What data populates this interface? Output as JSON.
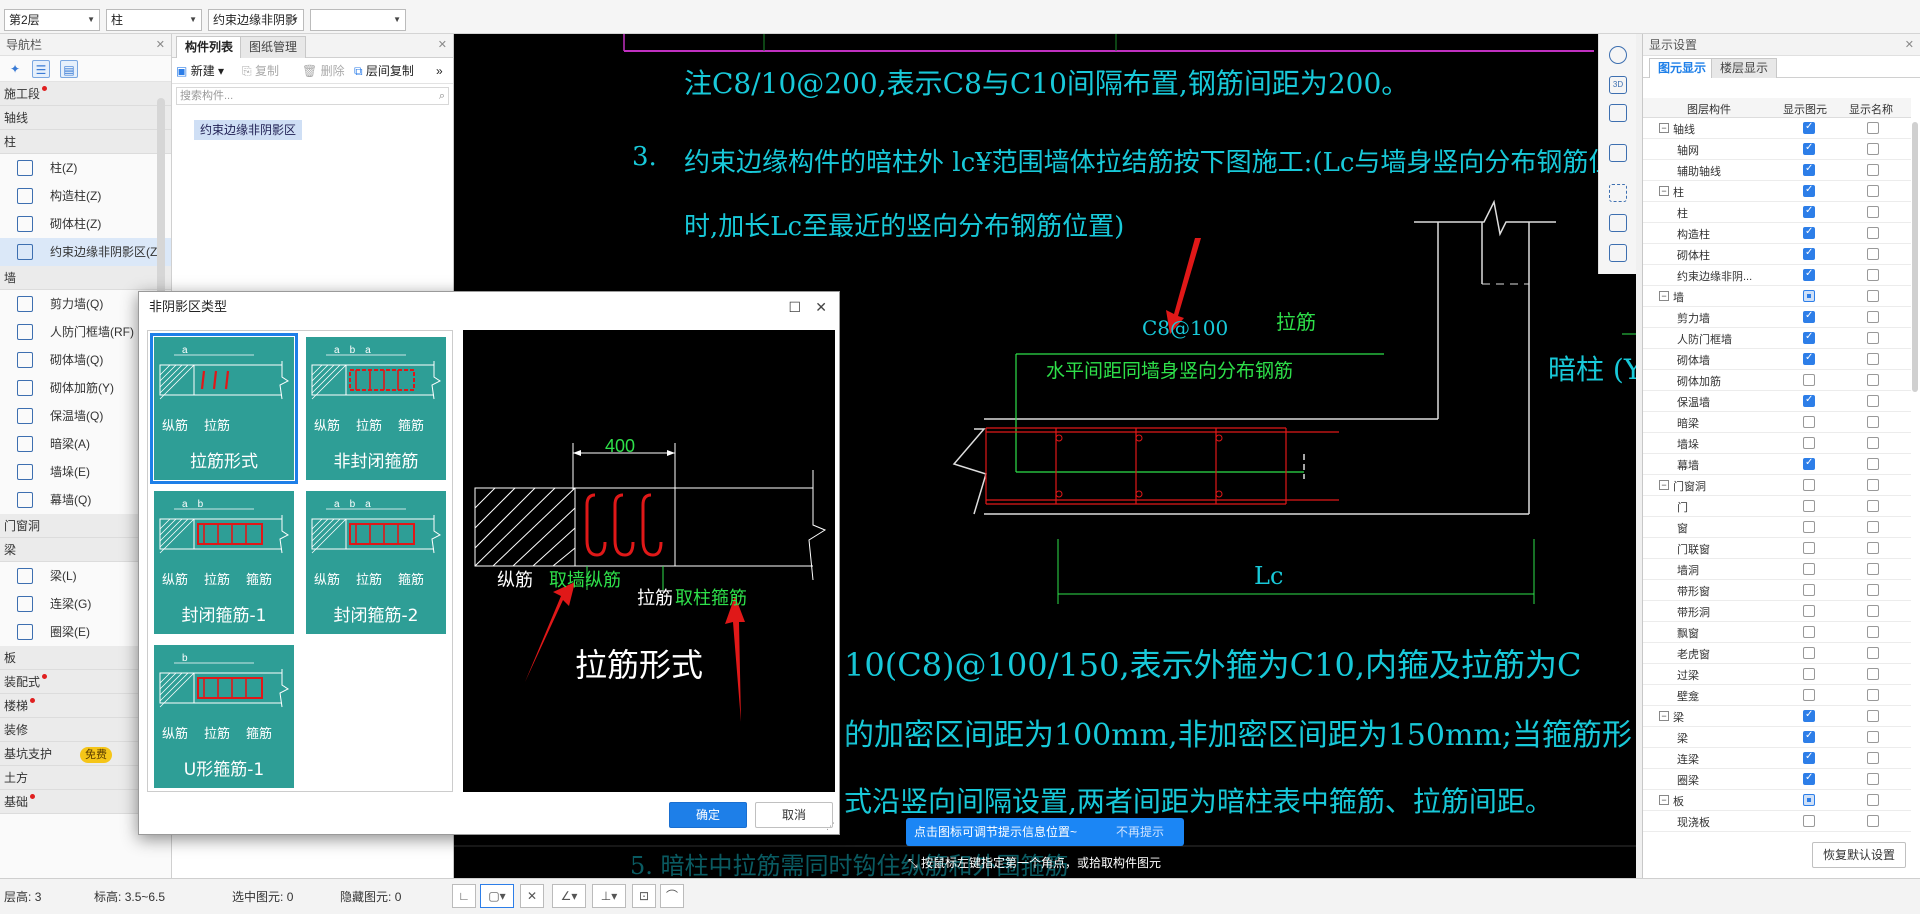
{
  "topbar": {
    "floor": "第2层",
    "type": "柱",
    "component": "约束边缘非阴影",
    "extra": ""
  },
  "nav": {
    "title": "导航栏",
    "categories_top": [
      {
        "label": "施工段",
        "dot": true
      },
      {
        "label": "轴线",
        "dot": false
      },
      {
        "label": "柱",
        "dot": false
      }
    ],
    "column_items": [
      {
        "label": "柱(Z)"
      },
      {
        "label": "构造柱(Z)"
      },
      {
        "label": "砌体柱(Z)"
      },
      {
        "label": "约束边缘非阴影区(Z"
      }
    ],
    "wall_cat": "墙",
    "wall_items": [
      {
        "label": "剪力墙(Q)"
      },
      {
        "label": "人防门框墙(RF)"
      },
      {
        "label": "砌体墙(Q)"
      },
      {
        "label": "砌体加筋(Y)"
      },
      {
        "label": "保温墙(Q)"
      },
      {
        "label": "暗梁(A)"
      },
      {
        "label": "墙垛(E)"
      },
      {
        "label": "幕墙(Q)"
      }
    ],
    "door_cat": "门窗洞",
    "beam_cat": "梁",
    "beam_items": [
      {
        "label": "梁(L)"
      },
      {
        "label": "连梁(G)"
      },
      {
        "label": "圈梁(E)"
      }
    ],
    "categories_bottom": [
      {
        "label": "板",
        "dot": false
      },
      {
        "label": "装配式",
        "dot": true
      },
      {
        "label": "楼梯",
        "dot": true
      },
      {
        "label": "装修",
        "dot": false
      },
      {
        "label": "基坑支护",
        "dot": false,
        "badge": "免费"
      },
      {
        "label": "土方",
        "dot": false
      },
      {
        "label": "基础",
        "dot": true
      }
    ]
  },
  "comp": {
    "tab1": "构件列表",
    "tab2": "图纸管理",
    "new": "新建",
    "copy": "复制",
    "delete": "删除",
    "floor_copy": "层间复制",
    "search_placeholder": "搜索构件...",
    "item": "约束边缘非阴影区"
  },
  "cad": {
    "line1": "注C8/10@200,表示C8与C10间隔布置,钢筋间距为200。",
    "num3": "3.",
    "line2": "约束边缘构件的暗柱外 lc¥范围墙体拉结筋按下图施工:(Lc与墙身竖向分布钢筋位置不同",
    "line3": "时,加长Lc至最近的竖向分布钢筋位置)",
    "label_c8": "C8@100",
    "label_lajin": "拉筋",
    "label_horizontal": "水平间距同墙身竖向分布钢筋",
    "label_anzhu": "暗柱 (Y",
    "label_lc": "Lc",
    "line4": "10(C8)@100/150,表示外箍为C10,内箍及拉筋为C",
    "line5": "的加密区间距为100mm,非加密区间距为150mm;当箍筋形",
    "line6": "式沿竖向间隔设置,两者间距为暗柱表中箍筋、拉筋间距。",
    "line7": "5.  暗柱中拉筋需同时钩住纵筋和外围箍筋"
  },
  "dialog": {
    "title": "非阴影区类型",
    "tiles": [
      {
        "label": "拉筋形式",
        "subs": [
          "纵筋",
          "拉筋"
        ],
        "dims": [
          "a"
        ]
      },
      {
        "label": "非封闭箍筋",
        "subs": [
          "纵筋",
          "拉筋",
          "箍筋"
        ],
        "dims": [
          "a",
          "b",
          "a"
        ]
      },
      {
        "label": "封闭箍筋-1",
        "subs": [
          "纵筋",
          "拉筋",
          "箍筋"
        ],
        "dims": [
          "a",
          "b"
        ]
      },
      {
        "label": "封闭箍筋-2",
        "subs": [
          "纵筋",
          "拉筋",
          "箍筋"
        ],
        "dims": [
          "a",
          "b",
          "a"
        ]
      },
      {
        "label": "U形箍筋-1",
        "subs": [
          "纵筋",
          "拉筋",
          "箍筋"
        ],
        "dims": [
          "b"
        ]
      }
    ],
    "preview": {
      "dim": "400",
      "zongjin": "纵筋",
      "zongjin_note": "取墙纵筋",
      "lajin": "拉筋",
      "lajin_note": "取柱箍筋",
      "caption": "拉筋形式"
    },
    "ok": "确定",
    "cancel": "取消"
  },
  "tip": {
    "text": "点击图标可调节提示信息位置~",
    "dismiss": "不再提示"
  },
  "hint": "按鼠标左键指定第一个角点，或拾取构件图元",
  "disp": {
    "title": "显示设置",
    "tab1": "图元显示",
    "tab2": "楼层显示",
    "col1": "图层构件",
    "col2": "显示图元",
    "col3": "显示名称",
    "rows": [
      {
        "name": "轴线",
        "group": true,
        "show": "on",
        "label": "off"
      },
      {
        "name": "轴网",
        "group": false,
        "show": "on",
        "label": "off"
      },
      {
        "name": "辅助轴线",
        "group": false,
        "show": "on",
        "label": "off"
      },
      {
        "name": "柱",
        "group": true,
        "show": "on",
        "label": "off"
      },
      {
        "name": "柱",
        "group": false,
        "show": "on",
        "label": "off"
      },
      {
        "name": "构造柱",
        "group": false,
        "show": "on",
        "label": "off"
      },
      {
        "name": "砌体柱",
        "group": false,
        "show": "on",
        "label": "off"
      },
      {
        "name": "约束边缘非阴...",
        "group": false,
        "show": "on",
        "label": "off"
      },
      {
        "name": "墙",
        "group": true,
        "show": "part",
        "label": "off"
      },
      {
        "name": "剪力墙",
        "group": false,
        "show": "on",
        "label": "off"
      },
      {
        "name": "人防门框墙",
        "group": false,
        "show": "on",
        "label": "off"
      },
      {
        "name": "砌体墙",
        "group": false,
        "show": "on",
        "label": "off"
      },
      {
        "name": "砌体加筋",
        "group": false,
        "show": "off",
        "label": "off"
      },
      {
        "name": "保温墙",
        "group": false,
        "show": "on",
        "label": "off"
      },
      {
        "name": "暗梁",
        "group": false,
        "show": "off",
        "label": "off"
      },
      {
        "name": "墙垛",
        "group": false,
        "show": "off",
        "label": "off"
      },
      {
        "name": "幕墙",
        "group": false,
        "show": "on",
        "label": "off"
      },
      {
        "name": "门窗洞",
        "group": true,
        "show": "off",
        "label": "off"
      },
      {
        "name": "门",
        "group": false,
        "show": "off",
        "label": "off"
      },
      {
        "name": "窗",
        "group": false,
        "show": "off",
        "label": "off"
      },
      {
        "name": "门联窗",
        "group": false,
        "show": "off",
        "label": "off"
      },
      {
        "name": "墙洞",
        "group": false,
        "show": "off",
        "label": "off"
      },
      {
        "name": "带形窗",
        "group": false,
        "show": "off",
        "label": "off"
      },
      {
        "name": "带形洞",
        "group": false,
        "show": "off",
        "label": "off"
      },
      {
        "name": "飘窗",
        "group": false,
        "show": "off",
        "label": "off"
      },
      {
        "name": "老虎窗",
        "group": false,
        "show": "off",
        "label": "off"
      },
      {
        "name": "过梁",
        "group": false,
        "show": "off",
        "label": "off"
      },
      {
        "name": "壁龛",
        "group": false,
        "show": "off",
        "label": "off"
      },
      {
        "name": "梁",
        "group": true,
        "show": "on",
        "label": "off"
      },
      {
        "name": "梁",
        "group": false,
        "show": "on",
        "label": "off"
      },
      {
        "name": "连梁",
        "group": false,
        "show": "on",
        "label": "off"
      },
      {
        "name": "圈梁",
        "group": false,
        "show": "on",
        "label": "off"
      },
      {
        "name": "板",
        "group": true,
        "show": "part",
        "label": "off"
      },
      {
        "name": "现浇板",
        "group": false,
        "show": "off",
        "label": "off"
      }
    ],
    "restore": "恢复默认设置"
  },
  "status": {
    "floor_height_label": "层高:",
    "floor_height": "3",
    "elev_label": "标高:",
    "elev": "3.5~6.5",
    "selected_label": "选中图元:",
    "selected": "0",
    "hidden_label": "隐藏图元:",
    "hidden": "0"
  },
  "colors": {
    "cad_cyan": "#18c9d9",
    "cad_green": "#2ee04a",
    "cad_red": "#e01818",
    "tile_teal": "#2e9e96",
    "accent_blue": "#1e7fe8"
  }
}
